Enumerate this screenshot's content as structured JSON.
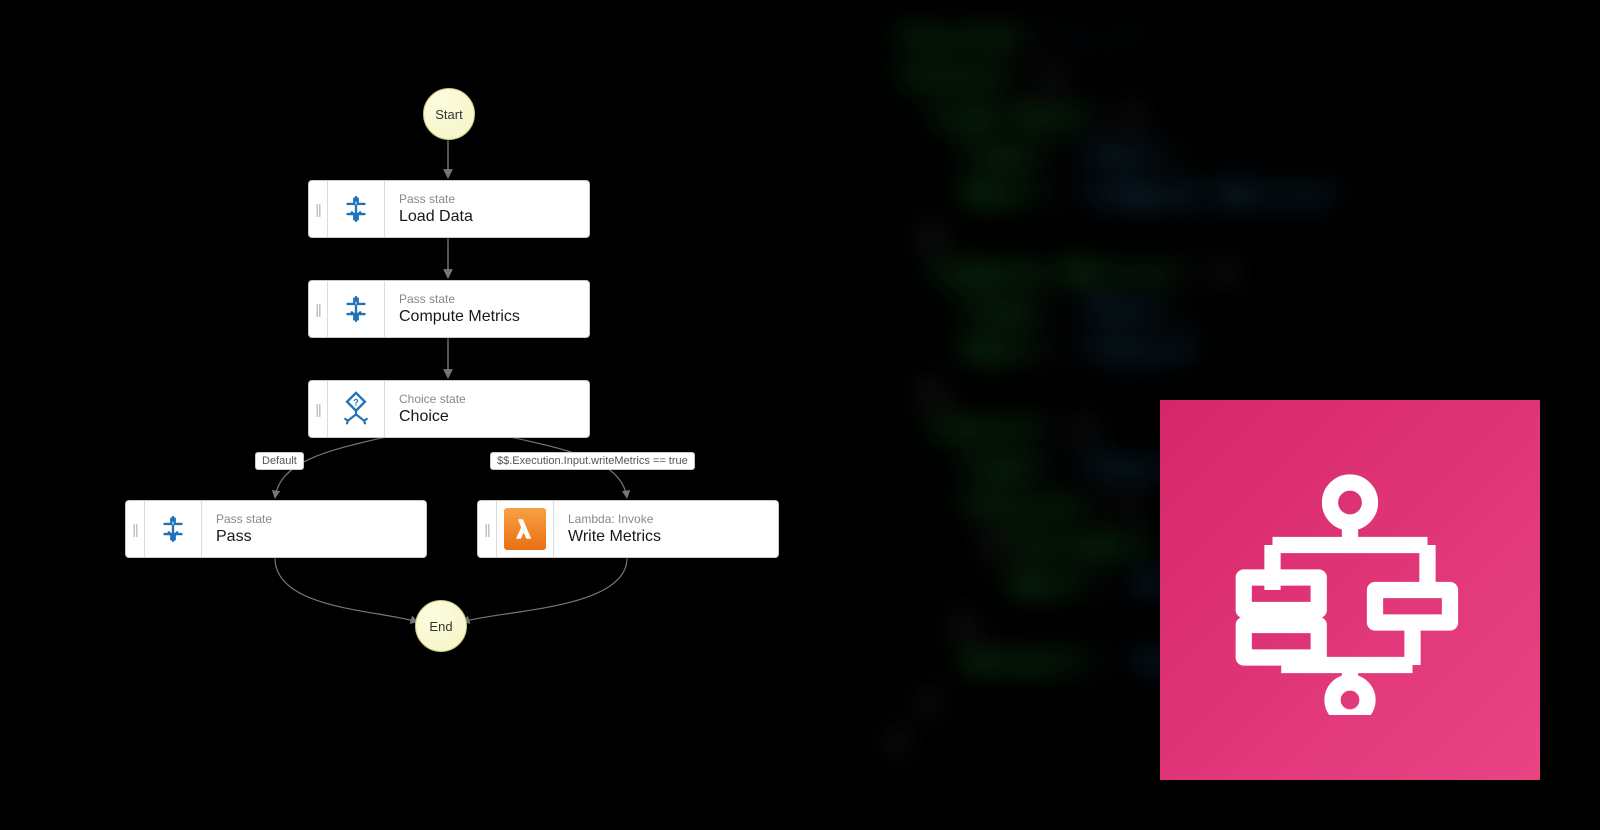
{
  "workflow": {
    "start": {
      "label": "Start"
    },
    "end": {
      "label": "End"
    },
    "states": {
      "load_data": {
        "type": "Pass state",
        "name": "Load Data"
      },
      "compute_metrics": {
        "type": "Pass state",
        "name": "Compute Metrics"
      },
      "choice": {
        "type": "Choice state",
        "name": "Choice"
      },
      "pass": {
        "type": "Pass state",
        "name": "Pass"
      },
      "write_metrics": {
        "type": "Lambda: Invoke",
        "name": "Write Metrics"
      }
    },
    "edges": {
      "default": "Default",
      "condition": "$$.Execution.Input.writeMetrics == true"
    }
  },
  "service_icon": {
    "name": "step-functions-service-icon",
    "color": "#e63674"
  }
}
